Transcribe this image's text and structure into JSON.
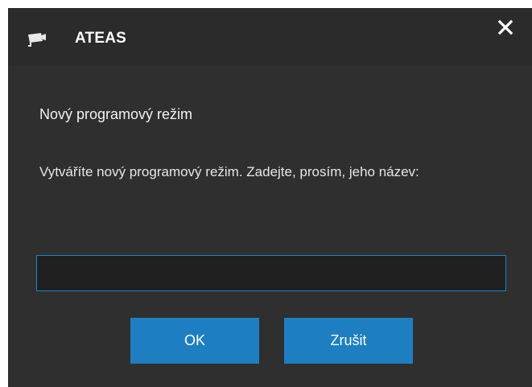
{
  "dialog": {
    "app_name": "ATEAS",
    "app_icon": "camera-icon",
    "close_icon": "close-icon",
    "heading": "Nový programový režim",
    "message": "Vytváříte nový programový režim. Zadejte, prosím, jeho název:",
    "input": {
      "value": "",
      "placeholder": ""
    },
    "ok_label": "OK",
    "cancel_label": "Zrušit"
  },
  "colors": {
    "background": "#2f2f2f",
    "titlebar": "#2b2b2b",
    "accent": "#1d7fc2",
    "input_border": "#1b86c9",
    "input_background": "#202020",
    "text": "#ffffff"
  }
}
